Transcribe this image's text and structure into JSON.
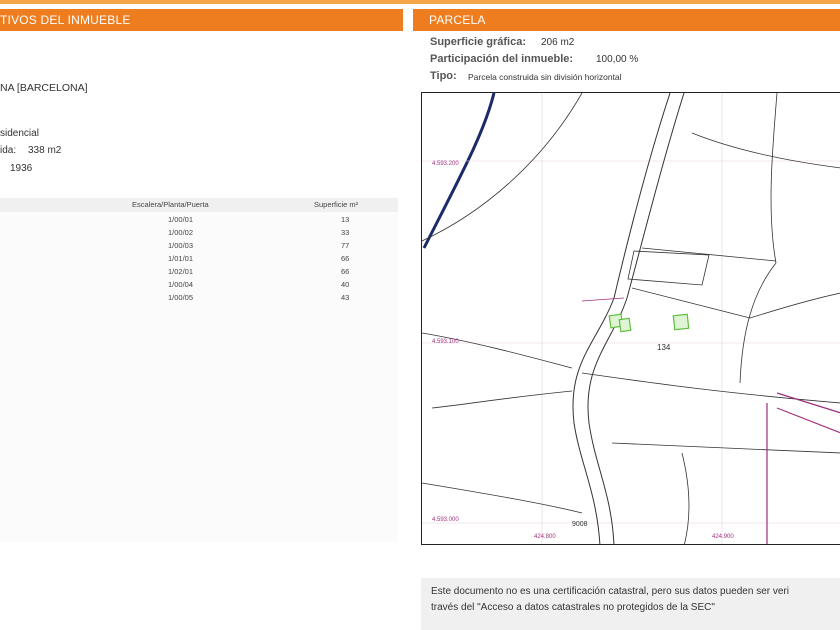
{
  "left_panel": {
    "header": "TIVOS DEL INMUEBLE",
    "location_text": "NA [BARCELONA]",
    "use_text": "sidencial",
    "built_surface_label": "ida:",
    "built_surface_value": "338 m2",
    "year_value": "1936",
    "table": {
      "headers": [
        "Escalera/Planta/Puerta",
        "Superficie m²"
      ],
      "rows": [
        [
          "1/00/01",
          "13"
        ],
        [
          "1/00/02",
          "33"
        ],
        [
          "1/00/03",
          "77"
        ],
        [
          "1/01/01",
          "66"
        ],
        [
          "1/02/01",
          "66"
        ],
        [
          "1/00/04",
          "40"
        ],
        [
          "1/00/05",
          "43"
        ]
      ]
    }
  },
  "right_panel": {
    "header": "PARCELA",
    "fields": [
      {
        "label": "Superficie gráfica:",
        "value": "206 m2"
      },
      {
        "label": "Participación del inmueble:",
        "value": "100,00 %"
      },
      {
        "label": "Tipo:",
        "value": "Parcela construida sin división horizontal"
      }
    ],
    "map": {
      "coord_labels": [
        "4.593.200",
        "4.593.100",
        "4.593.000",
        "424.800",
        "424.900"
      ],
      "parcel_number": "134",
      "road_number": "9008",
      "line_color": "#333333",
      "boundary_color": "#a0307a",
      "building_color": "#5fbf3f"
    }
  },
  "footer_note": {
    "line1": "Este documento no es una certificación catastral, pero sus datos pueden ser veri",
    "line2": "través del \"Acceso a datos catastrales no protegidos de la SEC\""
  }
}
